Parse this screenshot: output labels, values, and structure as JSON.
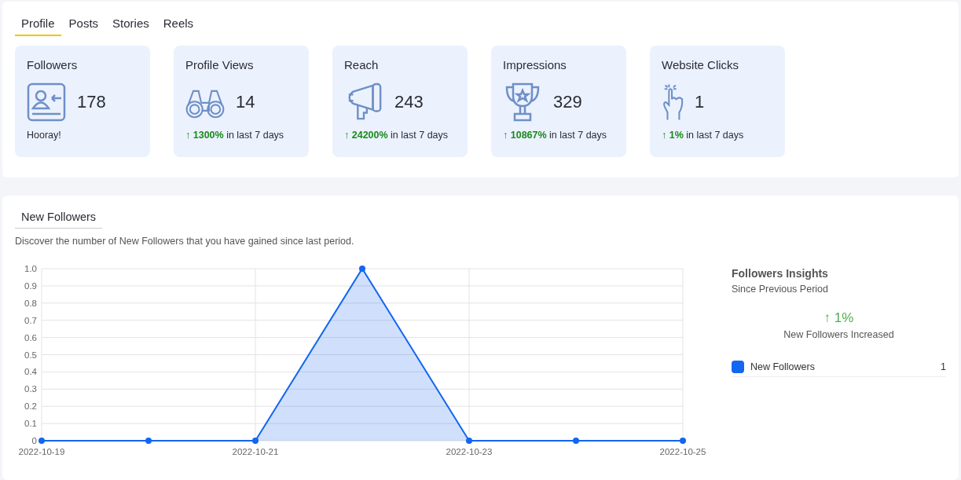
{
  "tabs": [
    {
      "label": "Profile",
      "selected": true
    },
    {
      "label": "Posts",
      "selected": false
    },
    {
      "label": "Stories",
      "selected": false
    },
    {
      "label": "Reels",
      "selected": false
    }
  ],
  "stats": [
    {
      "title": "Followers",
      "value": "178",
      "note": "Hooray!"
    },
    {
      "title": "Profile Views",
      "value": "14",
      "change": {
        "arrow": "↑",
        "percent": "1300%",
        "rest": "in last 7 days"
      }
    },
    {
      "title": "Reach",
      "value": "243",
      "change": {
        "arrow": "↑",
        "percent": "24200%",
        "rest": "in last 7 days"
      }
    },
    {
      "title": "Impressions",
      "value": "329",
      "change": {
        "arrow": "↑",
        "percent": "10867%",
        "rest": "in last 7 days"
      }
    },
    {
      "title": "Website Clicks",
      "value": "1",
      "change": {
        "arrow": "↑",
        "percent": "1%",
        "rest": "in last 7 days"
      }
    }
  ],
  "section": {
    "tab": "New Followers",
    "description": "Discover the number of New Followers that you have gained since last period.",
    "chart_data": {
      "type": "area",
      "categories": [
        "2022-10-19",
        null,
        "2022-10-21",
        null,
        "2022-10-23",
        null,
        "2022-10-25"
      ],
      "grid": true,
      "series": [
        {
          "name": "New Followers",
          "color": "#1266f1",
          "values": [
            0,
            0,
            0,
            1,
            0,
            0,
            0
          ]
        }
      ],
      "ylim": [
        0,
        1
      ],
      "yticks": [
        {
          "value": 0,
          "label": "0"
        },
        {
          "value": 0.1,
          "label": "0.1"
        },
        {
          "value": 0.2,
          "label": "0.2"
        },
        {
          "value": 0.3,
          "label": "0.3"
        },
        {
          "value": 0.4,
          "label": "0.4"
        },
        {
          "value": 0.5,
          "label": "0.5"
        },
        {
          "value": 0.6,
          "label": "0.6"
        },
        {
          "value": 0.7,
          "label": "0.7"
        },
        {
          "value": 0.8,
          "label": "0.8"
        },
        {
          "value": 0.9,
          "label": "0.9"
        },
        {
          "value": 1,
          "label": "1.0"
        }
      ]
    },
    "insights": {
      "title": "Followers Insights",
      "subtitle": "Since Previous Period",
      "arrow": "↑",
      "change": "1%",
      "caption": "New Followers Increased",
      "legend": [
        {
          "value": "1"
        }
      ]
    }
  }
}
